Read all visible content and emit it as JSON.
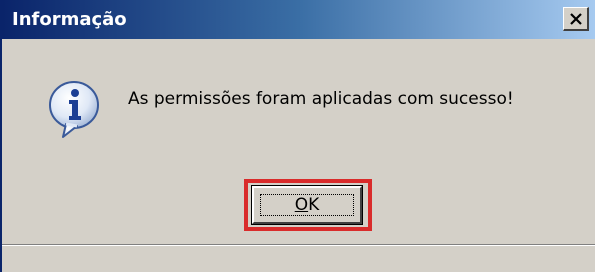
{
  "dialog": {
    "title": "Informação",
    "message": "As permissões foram aplicadas com sucesso!",
    "ok_mnemonic": "O",
    "ok_rest": "K",
    "icon": "info-icon",
    "close_icon": "close-icon"
  },
  "colors": {
    "titlebar_start": "#0a246a",
    "titlebar_end": "#a6caf0",
    "dialog_bg": "#d4d0c8",
    "highlight": "#d92b2b"
  }
}
